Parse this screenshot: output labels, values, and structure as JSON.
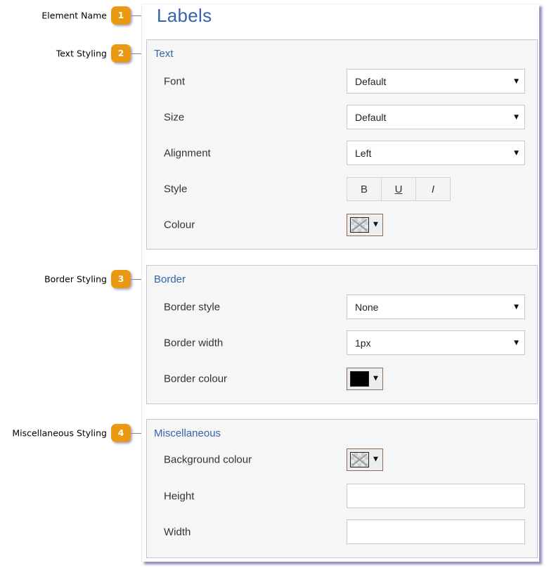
{
  "callouts": [
    {
      "number": "1",
      "label": "Element Name"
    },
    {
      "number": "2",
      "label": "Text Styling"
    },
    {
      "number": "3",
      "label": "Border Styling"
    },
    {
      "number": "4",
      "label": "Miscellaneous Styling"
    }
  ],
  "panel": {
    "title": "Labels",
    "text_section": {
      "legend": "Text",
      "font": {
        "label": "Font",
        "value": "Default"
      },
      "size": {
        "label": "Size",
        "value": "Default"
      },
      "alignment": {
        "label": "Alignment",
        "value": "Left"
      },
      "style": {
        "label": "Style",
        "bold": "B",
        "underline": "U",
        "italic": "I"
      },
      "colour": {
        "label": "Colour",
        "value": "transparent"
      }
    },
    "border_section": {
      "legend": "Border",
      "border_style": {
        "label": "Border style",
        "value": "None"
      },
      "border_width": {
        "label": "Border width",
        "value": "1px"
      },
      "border_colour": {
        "label": "Border colour",
        "value": "#000000"
      }
    },
    "misc_section": {
      "legend": "Miscellaneous",
      "background_colour": {
        "label": "Background colour",
        "value": "transparent"
      },
      "height": {
        "label": "Height",
        "value": ""
      },
      "width": {
        "label": "Width",
        "value": ""
      }
    }
  },
  "icons": {
    "caret": "▼"
  },
  "colors": {
    "accent": "#3763a8",
    "badge": "#ea9a12",
    "fieldset_bg": "#f6f6f6",
    "border_swatch": "#000000"
  }
}
